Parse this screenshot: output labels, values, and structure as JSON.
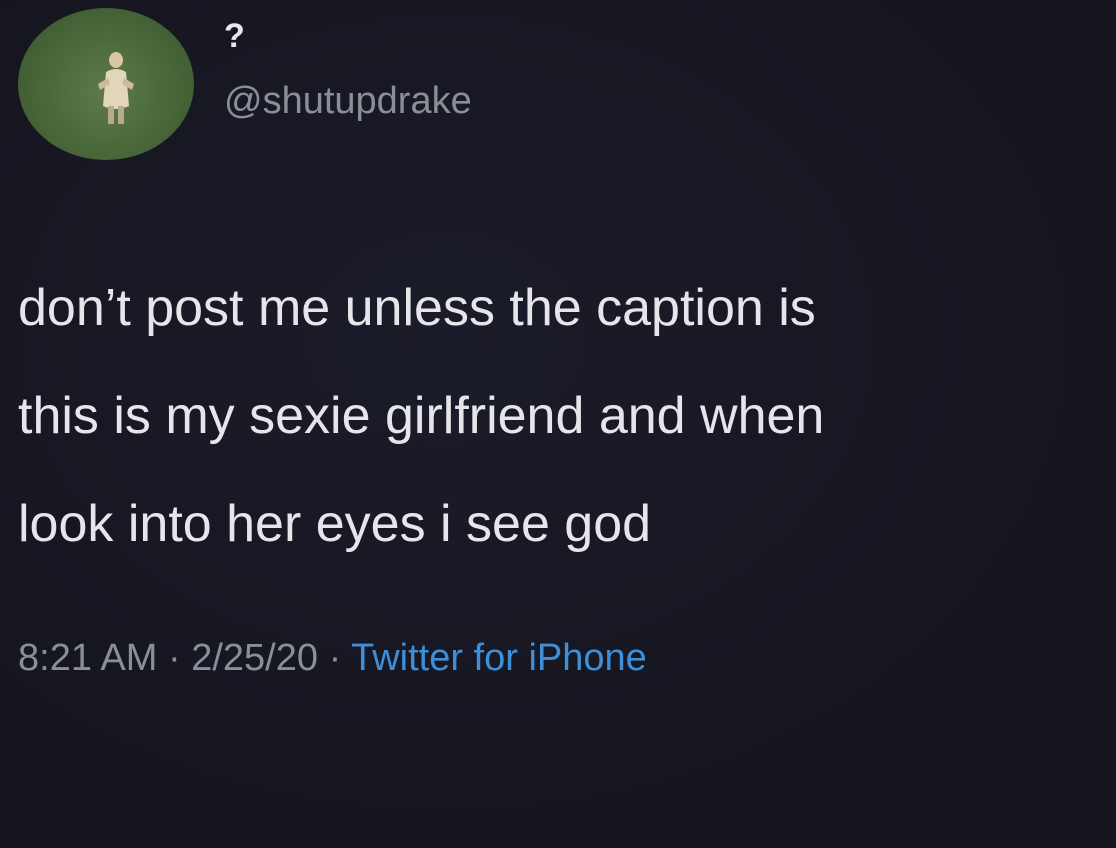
{
  "user": {
    "display_name": "?",
    "handle": "@shutupdrake",
    "avatar_icon": "profile-photo"
  },
  "tweet": {
    "lines": [
      "don’t post me unless the caption is",
      "this is my sexie girlfriend and when",
      "look into her eyes i see god"
    ],
    "time": "8:21 AM",
    "date": "2/25/20",
    "separator": "·",
    "source": "Twitter for iPhone"
  },
  "colors": {
    "background": "#15151f",
    "text": "#e6e6ea",
    "muted": "#8b8d97",
    "link": "#3c8fd8"
  }
}
